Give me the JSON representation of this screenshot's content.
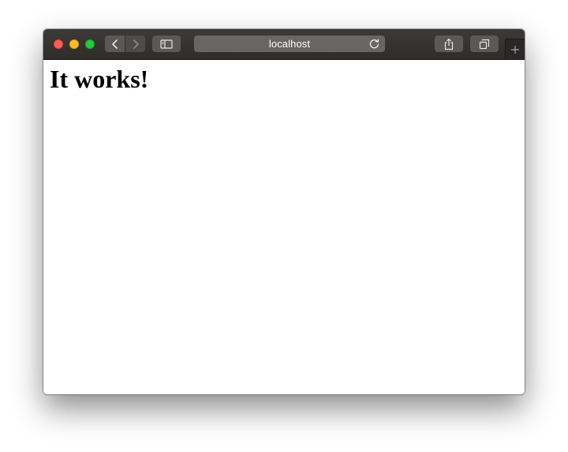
{
  "browser": {
    "address_bar": {
      "url": "localhost"
    },
    "colors": {
      "toolbar": "#35322f",
      "close": "#fe5f57",
      "minimize": "#febc2e",
      "zoom": "#28c840"
    },
    "icons": {
      "back": "chevron-left-icon",
      "forward": "chevron-right-icon",
      "sidebar": "sidebar-icon",
      "reload": "reload-icon",
      "share": "share-icon",
      "tabs": "tabs-overview-icon",
      "new_tab": "plus-icon"
    }
  },
  "page": {
    "heading": "It works!"
  }
}
